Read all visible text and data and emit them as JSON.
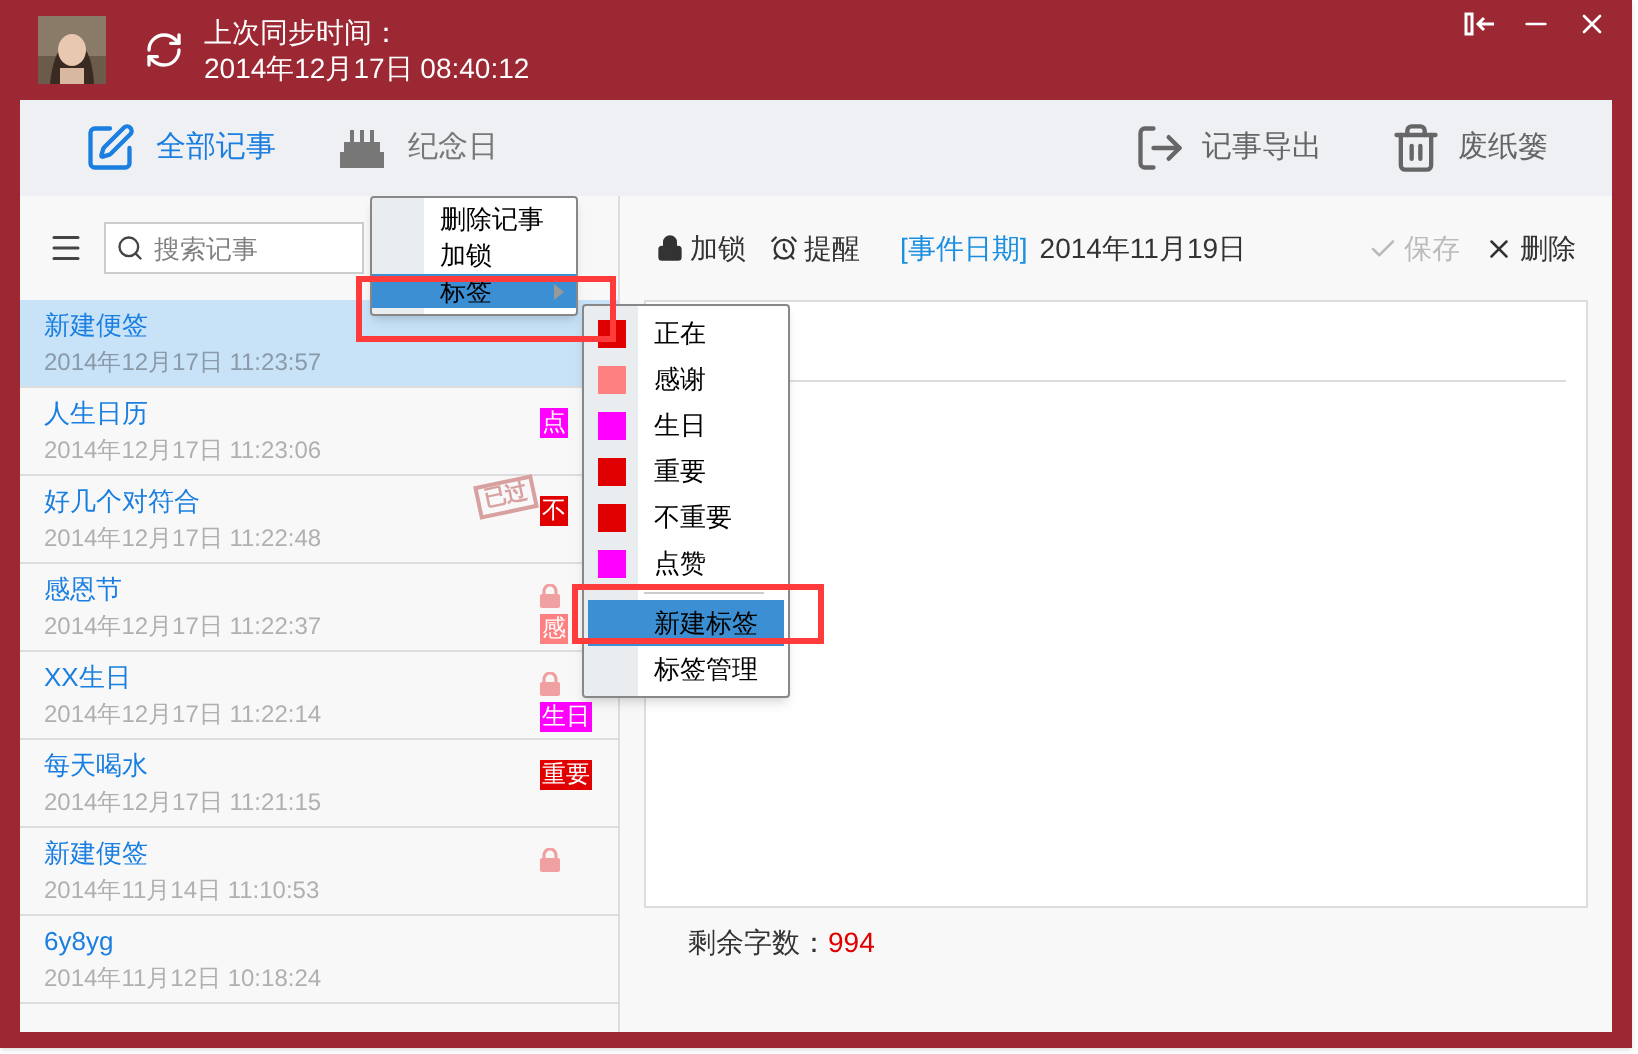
{
  "header": {
    "sync_label": "上次同步时间：",
    "sync_time": "2014年12月17日 08:40:12"
  },
  "nav": [
    {
      "label": "全部记事",
      "selected": true
    },
    {
      "label": "纪念日",
      "selected": false
    }
  ],
  "actions": [
    {
      "label": "记事导出"
    },
    {
      "label": "废纸篓"
    }
  ],
  "search": {
    "placeholder": "搜索记事"
  },
  "notes": [
    {
      "title": "新建便签",
      "time": "2014年12月17日 11:23:57",
      "selected": true,
      "locked": false
    },
    {
      "title": "人生日历",
      "time": "2014年12月17日 11:23:06",
      "selected": false,
      "locked": false,
      "tag": "点",
      "color": "#ff00ff"
    },
    {
      "title": "好几个对符合",
      "time": "2014年12月17日 11:22:48",
      "selected": false,
      "locked": false,
      "tag": "不",
      "color": "#e00000",
      "stamp": "已过"
    },
    {
      "title": "感恩节",
      "time": "2014年12月17日 11:22:37",
      "selected": false,
      "locked": true,
      "tag": "感",
      "color": "#ff8080"
    },
    {
      "title": "XX生日",
      "time": "2014年12月17日 11:22:14",
      "selected": false,
      "locked": true,
      "tag": "生日",
      "color": "#ff00ff"
    },
    {
      "title": "每天喝水",
      "time": "2014年12月17日 11:21:15",
      "selected": false,
      "locked": false,
      "tag": "重要",
      "color": "#e00000"
    },
    {
      "title": "新建便签",
      "time": "2014年11月14日 11:10:53",
      "selected": false,
      "locked": true
    },
    {
      "title": "6y8yg",
      "time": "2014年11月12日 10:18:24",
      "selected": false,
      "locked": false
    }
  ],
  "editor_toolbar": {
    "lock": "加锁",
    "remind": "提醒",
    "date_label": "[事件日期]",
    "date": "2014年11月19日",
    "save": {
      "label": "保存",
      "disabled": true
    },
    "delete": "删除"
  },
  "remaining": {
    "label": "剩余字数：",
    "value": "994"
  },
  "context_menu": [
    {
      "label": "删除记事",
      "selected": false,
      "submenu": false
    },
    {
      "label": "加锁",
      "selected": false,
      "submenu": false
    },
    {
      "label": "标签",
      "selected": true,
      "submenu": true
    }
  ],
  "tag_menu": [
    {
      "kind": "tag",
      "label": "正在",
      "color": "#e00000",
      "selected": false
    },
    {
      "kind": "tag",
      "label": "感谢",
      "color": "#ff8080",
      "selected": false
    },
    {
      "kind": "tag",
      "label": "生日",
      "color": "#ff00ff",
      "selected": false
    },
    {
      "kind": "tag",
      "label": "重要",
      "color": "#e00000",
      "selected": false
    },
    {
      "kind": "tag",
      "label": "不重要",
      "color": "#e00000",
      "selected": false
    },
    {
      "kind": "tag",
      "label": "点赞",
      "color": "#ff00ff",
      "selected": false
    },
    {
      "kind": "separator"
    },
    {
      "kind": "action",
      "label": "新建标签",
      "selected": true
    },
    {
      "kind": "action",
      "label": "标签管理",
      "selected": false
    }
  ]
}
